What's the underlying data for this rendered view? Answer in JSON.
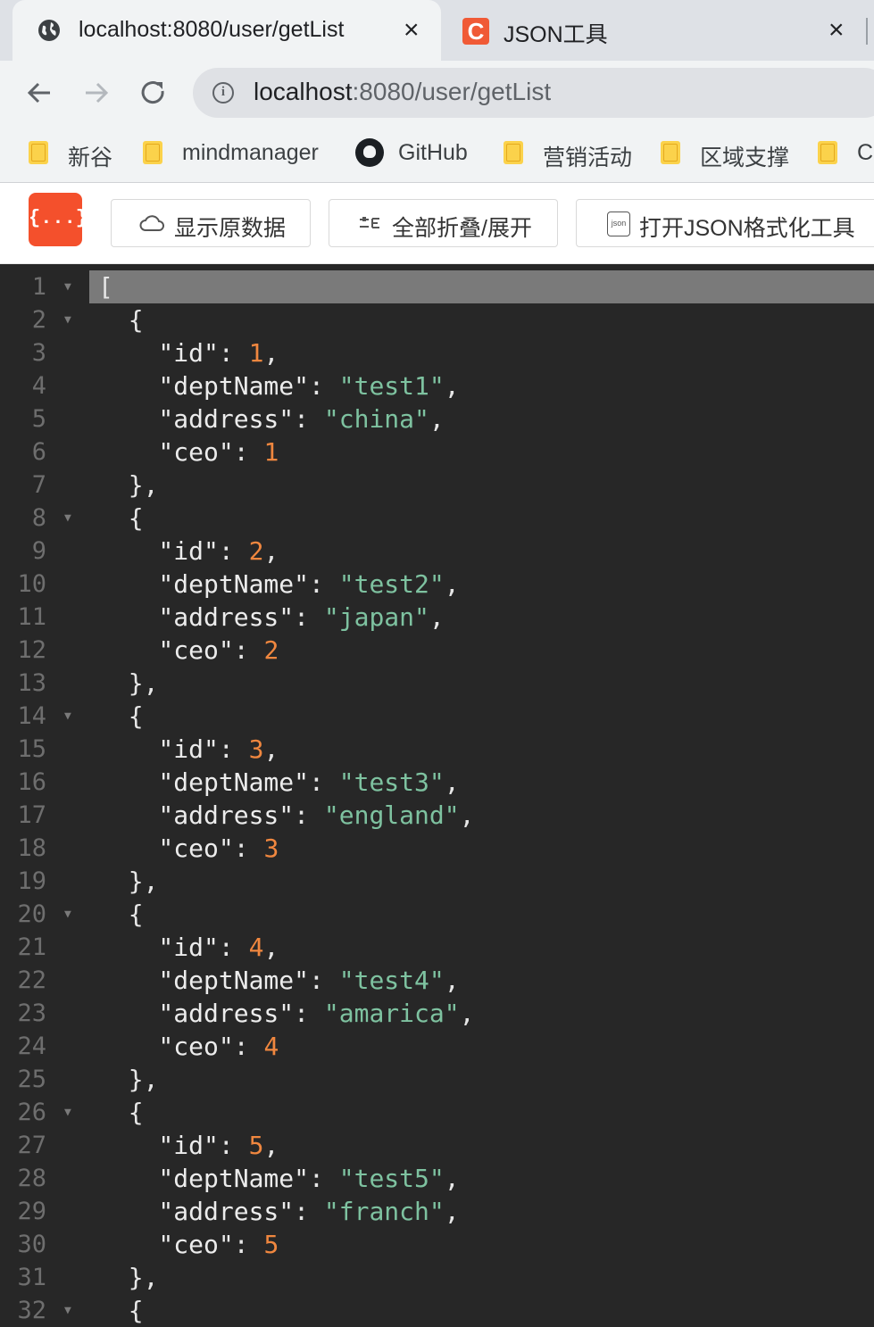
{
  "browser": {
    "active_tab": {
      "title": "localhost:8080/user/getList",
      "close": "×"
    },
    "inactive_tab": {
      "title": "JSON工具",
      "icon_letter": "C",
      "close": "×"
    },
    "url": {
      "host": "localhost",
      "rest": ":8080/user/getList"
    },
    "bookmarks": [
      {
        "label": "新谷"
      },
      {
        "label": "mindmanager"
      },
      {
        "label": "GitHub"
      },
      {
        "label": "营销活动"
      },
      {
        "label": "区域支撑"
      },
      {
        "label": "Cl"
      }
    ]
  },
  "json_tool": {
    "logo": "{...}",
    "buttons": {
      "show_raw": "显示原数据",
      "fold_all": "全部折叠/展开",
      "open_formatter": "打开JSON格式化工具"
    }
  },
  "editor": {
    "records": [
      {
        "id": "1",
        "deptName": "\"test1\"",
        "address": "\"china\"",
        "ceo": "1"
      },
      {
        "id": "2",
        "deptName": "\"test2\"",
        "address": "\"japan\"",
        "ceo": "2"
      },
      {
        "id": "3",
        "deptName": "\"test3\"",
        "address": "\"england\"",
        "ceo": "3"
      },
      {
        "id": "4",
        "deptName": "\"test4\"",
        "address": "\"amarica\"",
        "ceo": "4"
      },
      {
        "id": "5",
        "deptName": "\"test5\"",
        "address": "\"franch\"",
        "ceo": "5"
      }
    ],
    "line_numbers": [
      "1",
      "2",
      "3",
      "4",
      "5",
      "6",
      "7",
      "8",
      "9",
      "10",
      "11",
      "12",
      "13",
      "14",
      "15",
      "16",
      "17",
      "18",
      "19",
      "20",
      "21",
      "22",
      "23",
      "24",
      "25",
      "26",
      "27",
      "28",
      "29",
      "30",
      "31",
      "32"
    ]
  },
  "colors": {
    "number": "#f0873f",
    "string": "#7ec2a0",
    "background": "#272727",
    "logo": "#f4502c"
  }
}
